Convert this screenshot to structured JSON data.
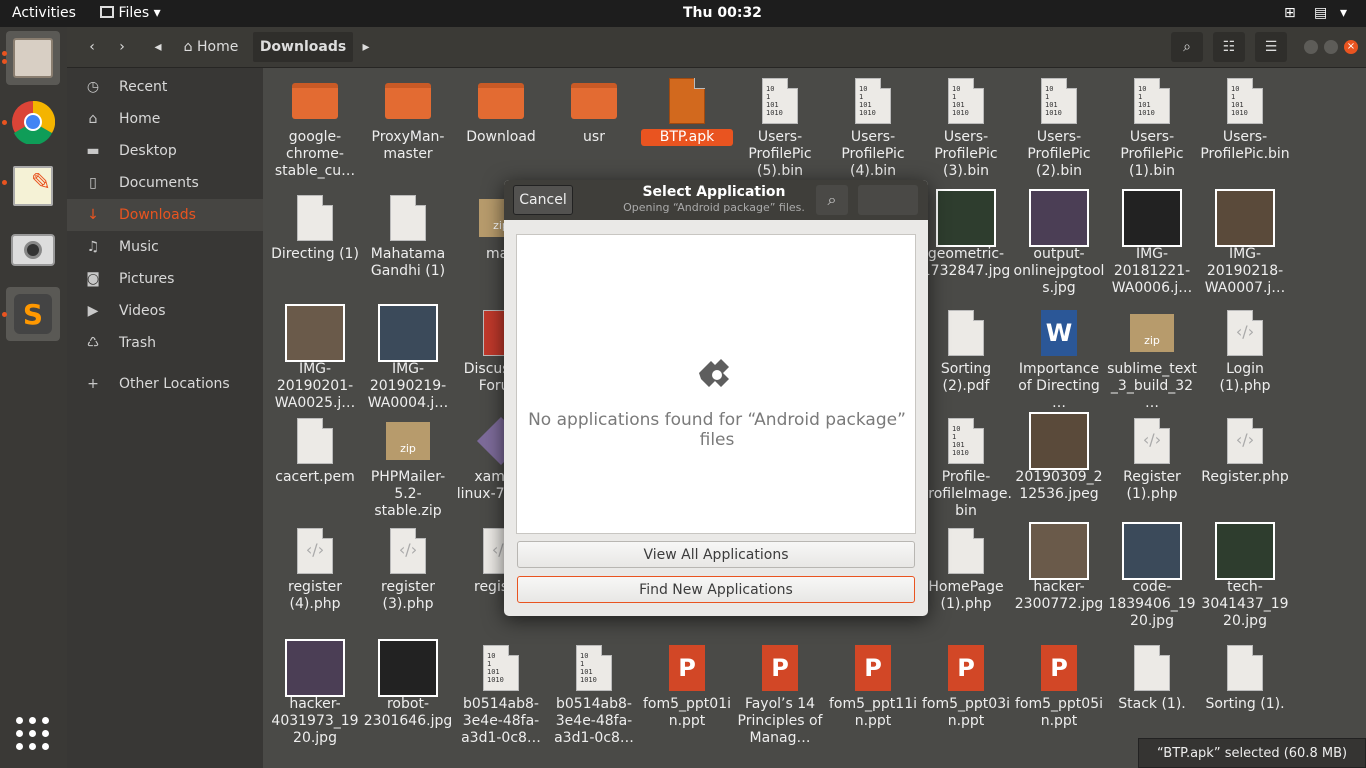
{
  "topbar": {
    "activities": "Activities",
    "app_name": "Files",
    "clock": "Thu 00:32"
  },
  "pathbar": {
    "home": "Home",
    "current": "Downloads"
  },
  "sidebar": {
    "items": [
      {
        "label": "Recent",
        "icon": "clock-icon"
      },
      {
        "label": "Home",
        "icon": "home-icon"
      },
      {
        "label": "Desktop",
        "icon": "folder-icon"
      },
      {
        "label": "Documents",
        "icon": "document-icon"
      },
      {
        "label": "Downloads",
        "icon": "download-icon"
      },
      {
        "label": "Music",
        "icon": "music-icon"
      },
      {
        "label": "Pictures",
        "icon": "camera-icon"
      },
      {
        "label": "Videos",
        "icon": "video-icon"
      },
      {
        "label": "Trash",
        "icon": "trash-icon"
      }
    ],
    "other": "Other Locations"
  },
  "files": [
    {
      "label": "google-chrome-stable_cu…",
      "type": "folder"
    },
    {
      "label": "ProxyMan-master",
      "type": "folder"
    },
    {
      "label": "Download",
      "type": "folder"
    },
    {
      "label": "usr",
      "type": "folder"
    },
    {
      "label": "BTP.apk",
      "type": "apk"
    },
    {
      "label": "Users-ProfilePic (5).bin",
      "type": "bin"
    },
    {
      "label": "Users-ProfilePic (4).bin",
      "type": "bin"
    },
    {
      "label": "Users-ProfilePic (3).bin",
      "type": "bin"
    },
    {
      "label": "Users-ProfilePic (2).bin",
      "type": "bin"
    },
    {
      "label": "Users-ProfilePic (1).bin",
      "type": "bin"
    },
    {
      "label": "Users-ProfilePic.bin",
      "type": "bin"
    },
    {
      "label": "Directing (1)",
      "type": "doc"
    },
    {
      "label": "Mahatama Gandhi (1)",
      "type": "doc"
    },
    {
      "label": "mail",
      "type": "zip"
    },
    {
      "label": "geometric-1732847.jpg",
      "type": "img"
    },
    {
      "label": "output-onlinejpgtools.jpg",
      "type": "img"
    },
    {
      "label": "IMG-20181221-WA0006.j…",
      "type": "img"
    },
    {
      "label": "IMG-20190218-WA0007.j…",
      "type": "img"
    },
    {
      "label": "IMG-20190201-WA0025.j…",
      "type": "img"
    },
    {
      "label": "IMG-20190219-WA0004.j…",
      "type": "img"
    },
    {
      "label": "Discussion Forum",
      "type": "pdf"
    },
    {
      "label": "Sorting (2).pdf",
      "type": "doc"
    },
    {
      "label": "Importance of Directing …",
      "type": "word"
    },
    {
      "label": "sublime_text_3_build_32…",
      "type": "zip"
    },
    {
      "label": "Login (1).php",
      "type": "code"
    },
    {
      "label": "cacert.pem",
      "type": "doc"
    },
    {
      "label": "PHPMailer-5.2-stable.zip",
      "type": "zip"
    },
    {
      "label": "xampp-linux-7.3.3-0",
      "type": "pkg"
    },
    {
      "label": "Profile-ProfileImage.bin",
      "type": "bin"
    },
    {
      "label": "20190309_212536.jpeg",
      "type": "img"
    },
    {
      "label": "Register (1).php",
      "type": "code"
    },
    {
      "label": "Register.php",
      "type": "code"
    },
    {
      "label": "register (4).php",
      "type": "code"
    },
    {
      "label": "register (3).php",
      "type": "code"
    },
    {
      "label": "register",
      "type": "code"
    },
    {
      "label": "HomePage (1).php",
      "type": "doc"
    },
    {
      "label": "hacker-2300772.jpg",
      "type": "img"
    },
    {
      "label": "code-1839406_1920.jpg",
      "type": "img"
    },
    {
      "label": "tech-3041437_1920.jpg",
      "type": "img"
    },
    {
      "label": "hacker-4031973_1920.jpg",
      "type": "img"
    },
    {
      "label": "robot-2301646.jpg",
      "type": "img"
    },
    {
      "label": "b0514ab8-3e4e-48fa-a3d1-0c8…",
      "type": "bin"
    },
    {
      "label": "b0514ab8-3e4e-48fa-a3d1-0c8…",
      "type": "bin"
    },
    {
      "label": "fom5_ppt01in.ppt",
      "type": "ppt"
    },
    {
      "label": "Fayol’s 14 Principles of Manag…",
      "type": "ppt"
    },
    {
      "label": "fom5_ppt11in.ppt",
      "type": "ppt"
    },
    {
      "label": "fom5_ppt03in.ppt",
      "type": "ppt"
    },
    {
      "label": "fom5_ppt05in.ppt",
      "type": "ppt"
    },
    {
      "label": "Stack (1).",
      "type": "doc"
    },
    {
      "label": "Sorting (1).",
      "type": "doc"
    }
  ],
  "status": "“BTP.apk” selected  (60.8 MB)",
  "dialog": {
    "cancel": "Cancel",
    "title": "Select Application",
    "subtitle": "Opening “Android package” files.",
    "empty_message": "No applications found for “Android package” files",
    "view_all": "View All Applications",
    "find_new": "Find New Applications"
  },
  "colors": {
    "accent": "#e95420",
    "folder": "#e36b32"
  }
}
